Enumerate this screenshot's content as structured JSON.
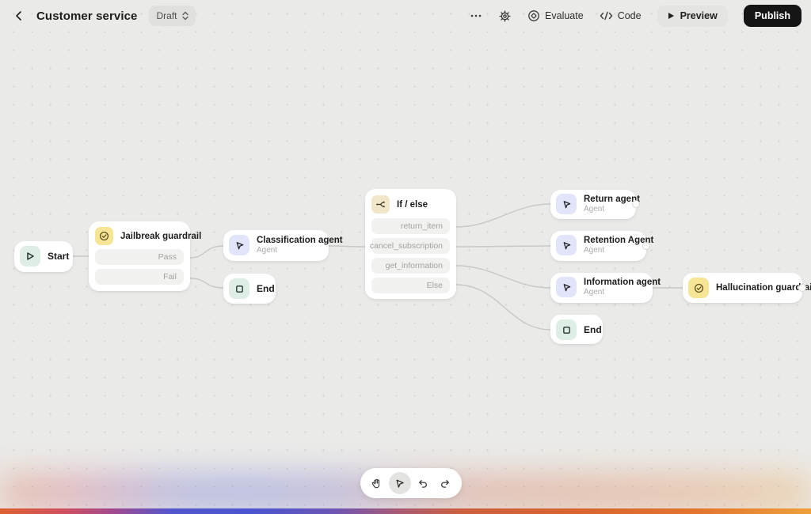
{
  "header": {
    "title": "Customer service",
    "status_label": "Draft",
    "evaluate_label": "Evaluate",
    "code_label": "Code",
    "preview_label": "Preview",
    "publish_label": "Publish"
  },
  "nodes": {
    "start": {
      "title": "Start",
      "icon": "play-icon"
    },
    "jailbreak": {
      "title": "Jailbreak guardrail",
      "icon": "guardrail-check-icon",
      "rows": [
        "Pass",
        "Fail"
      ]
    },
    "classification": {
      "title": "Classification agent",
      "subtitle": "Agent",
      "icon": "agent-cursor-icon"
    },
    "end1": {
      "title": "End",
      "icon": "stop-square-icon"
    },
    "ifelse": {
      "title": "If / else",
      "icon": "branch-icon",
      "rows": [
        "return_item",
        "cancel_subscription",
        "get_information",
        "Else"
      ]
    },
    "return_agent": {
      "title": "Return agent",
      "subtitle": "Agent",
      "icon": "agent-cursor-icon"
    },
    "retention_agent": {
      "title": "Retention Agent",
      "subtitle": "Agent",
      "icon": "agent-cursor-icon"
    },
    "information_agent": {
      "title": "Information agent",
      "subtitle": "Agent",
      "icon": "agent-cursor-icon"
    },
    "end2": {
      "title": "End",
      "icon": "stop-square-icon"
    },
    "hallucination": {
      "title": "Hallucination guardrail",
      "icon": "guardrail-check-icon"
    }
  },
  "colors": {
    "canvas_bg": "#eaeae8",
    "card_bg": "#ffffff",
    "guardrail_icon_bg": "#f6e594",
    "agent_icon_bg": "#e2e4fa",
    "terminal_icon_bg": "#dfeee5",
    "logic_icon_bg": "#f2e6c9",
    "publish_bg": "#151515",
    "edge": "#c8c8c6"
  },
  "toolbar": {
    "tools": [
      "pan",
      "select",
      "undo",
      "redo"
    ],
    "active_tool": "select"
  }
}
